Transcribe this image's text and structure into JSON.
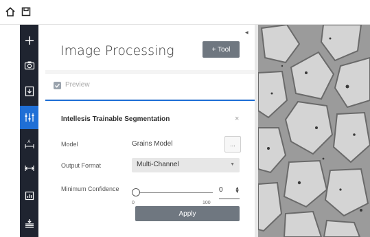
{
  "toolbar": {
    "home_icon": "home-icon",
    "save_icon": "save-icon"
  },
  "sidebar": {
    "items": [
      {
        "icon": "plus-icon"
      },
      {
        "icon": "camera-icon"
      },
      {
        "icon": "import-icon"
      },
      {
        "icon": "adjust-icon",
        "active": true
      },
      {
        "icon": "measure-icon"
      },
      {
        "icon": "range-icon"
      },
      {
        "icon": "chart-icon"
      },
      {
        "icon": "layers-icon"
      }
    ]
  },
  "panel": {
    "title": "Image Processing",
    "add_tool_label": "+ Tool",
    "preview_label": "Preview",
    "tool_card": {
      "title": "Intellesis Trainable Segmentation",
      "close_label": "×",
      "model_label": "Model",
      "model_value": "Grains Model",
      "model_more_label": "...",
      "output_label": "Output Format",
      "output_value": "Multi-Channel",
      "confidence_label": "Minimum Confidence",
      "confidence_value": "0",
      "slider_min": "0",
      "slider_max": "100",
      "apply_label": "Apply"
    }
  },
  "colors": {
    "accent": "#1f6fd6",
    "sidebar_bg": "#1f2430",
    "button_bg": "#6f7780"
  }
}
